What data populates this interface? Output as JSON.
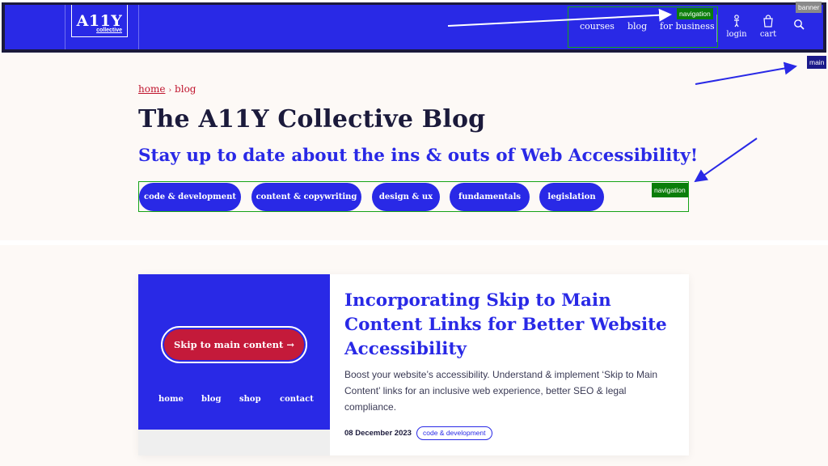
{
  "header": {
    "logo_main": "A11Y",
    "logo_sub": "collective",
    "nav": [
      {
        "label": "courses"
      },
      {
        "label": "blog"
      },
      {
        "label": "for business"
      }
    ],
    "login_label": "login",
    "cart_label": "cart",
    "landmark_nav": "navigation",
    "landmark_banner": "banner"
  },
  "main": {
    "landmark_main": "main",
    "breadcrumb": {
      "home": "home",
      "separator": "›",
      "current": "blog"
    },
    "title": "The A11Y Collective Blog",
    "subtitle": "Stay up to date about the ins & outs of Web Accessibility!",
    "landmark_nav": "navigation",
    "categories": [
      {
        "label": "code & development"
      },
      {
        "label": "content & copywriting"
      },
      {
        "label": "design & ux"
      },
      {
        "label": "fundamentals"
      },
      {
        "label": "legislation"
      }
    ],
    "article": {
      "image_button": "Skip to main content  →",
      "image_nav": [
        "home",
        "blog",
        "shop",
        "contact"
      ],
      "title": "Incorporating Skip to Main Content Links for Better Website Accessibility",
      "excerpt": "Boost your website’s accessibility. Understand & implement ‘Skip to Main Content’ links for an inclusive web experience, better SEO & legal compliance.",
      "date": "08 December 2023",
      "tag": "code & development"
    }
  },
  "colors": {
    "brand_blue": "#2929e6",
    "brand_red": "#c41a3a",
    "text_dark": "#1b1a3b",
    "annotation_green": "#16a316"
  }
}
